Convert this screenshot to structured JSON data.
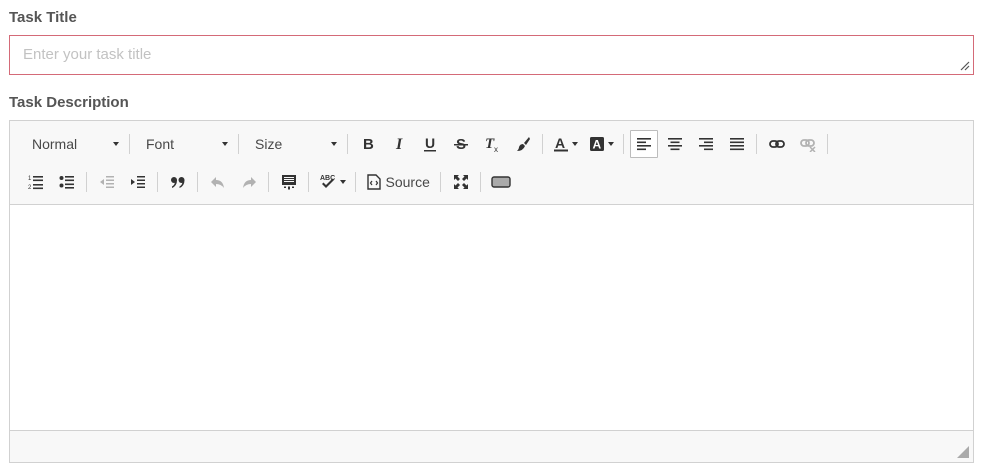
{
  "task_title": {
    "label": "Task Title",
    "placeholder": "Enter your task title",
    "value": ""
  },
  "task_description": {
    "label": "Task Description",
    "toolbar": {
      "format_combo": "Normal",
      "font_combo": "Font",
      "size_combo": "Size",
      "source_label": "Source"
    },
    "content": ""
  },
  "colors": {
    "invalid_border": "#d46a78",
    "toolbar_bg": "#f8f8f8",
    "border": "#d1d1d1",
    "label_text": "#555555",
    "placeholder_text": "#c2c2c2"
  }
}
